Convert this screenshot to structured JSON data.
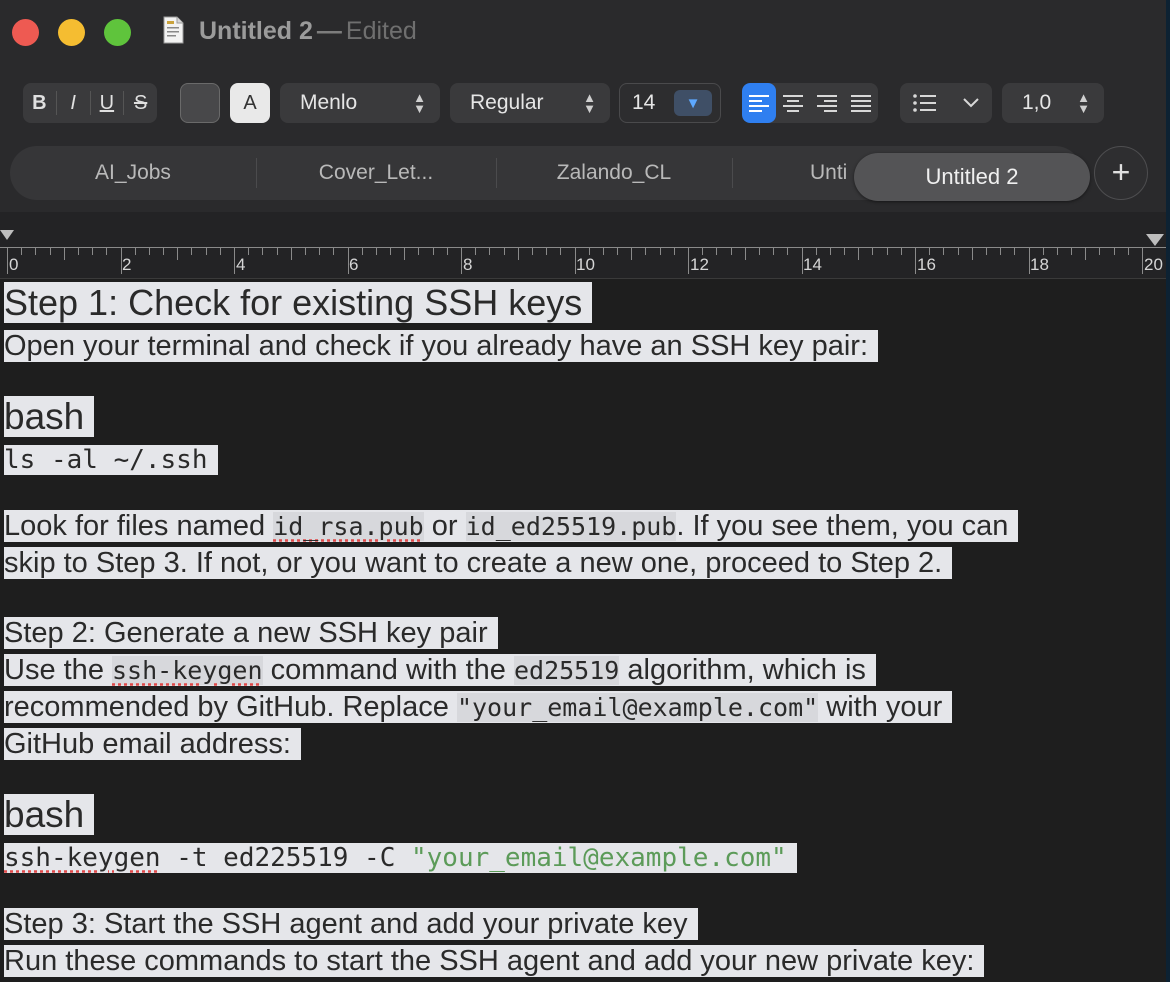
{
  "window": {
    "title": "Untitled 2",
    "title_separator": "—",
    "status": "Edited"
  },
  "toolbar": {
    "style_buttons": [
      "B",
      "I",
      "U",
      "S"
    ],
    "bg_swatch_label": "A",
    "font_family": "Menlo",
    "font_style": "Regular",
    "font_size": "14",
    "line_spacing": "1,0",
    "align_buttons": [
      "align-left",
      "align-center",
      "align-right",
      "justify"
    ],
    "active_align": "align-left",
    "accent_color": "#2f7ff0"
  },
  "tabs": {
    "items": [
      "AI_Jobs",
      "Cover_Let...",
      "Zalando_CL",
      "Unti"
    ],
    "active": "Untitled 2",
    "new_tab_label": "+"
  },
  "ruler": {
    "labels": [
      "0",
      "2",
      "4",
      "6",
      "8",
      "10",
      "12",
      "14",
      "16",
      "18",
      "20"
    ]
  },
  "document": {
    "step1_heading": "Step 1: Check for existing SSH keys",
    "step1_text": "Open your terminal and check if you already have an SSH key pair:",
    "bash_label_1": "bash",
    "command_1": "ls -al ~/.ssh",
    "look_p1": "Look for files named ",
    "look_code1": "id_rsa.pub",
    "look_p2": " or ",
    "look_code2": "id_ed25519.pub",
    "look_p3": ". If you see them, you can",
    "look_line2": "skip to Step 3. If not, or you want to create a new one, proceed to Step 2.",
    "step2_heading": "Step 2: Generate a new SSH key pair",
    "use_p1": "Use the ",
    "use_code1": "ssh-keygen",
    "use_p2": " command with the ",
    "use_code2": "ed25519",
    "use_p3": " algorithm, which is",
    "rec_p1": "recommended by GitHub. Replace ",
    "rec_code": "\"your_email@example.com\"",
    "rec_p2": " with your",
    "github_line": "GitHub email address:",
    "bash_label_2": "bash",
    "command_2_cmd": "ssh-keygen",
    "command_2_args": " -t ed225519 -C ",
    "command_2_string": "\"your_email@example.com\"",
    "step3_heading": "Step 3: Start the SSH agent and add your private key",
    "step3_text": "Run these commands to start the SSH agent and add your new private key:"
  }
}
